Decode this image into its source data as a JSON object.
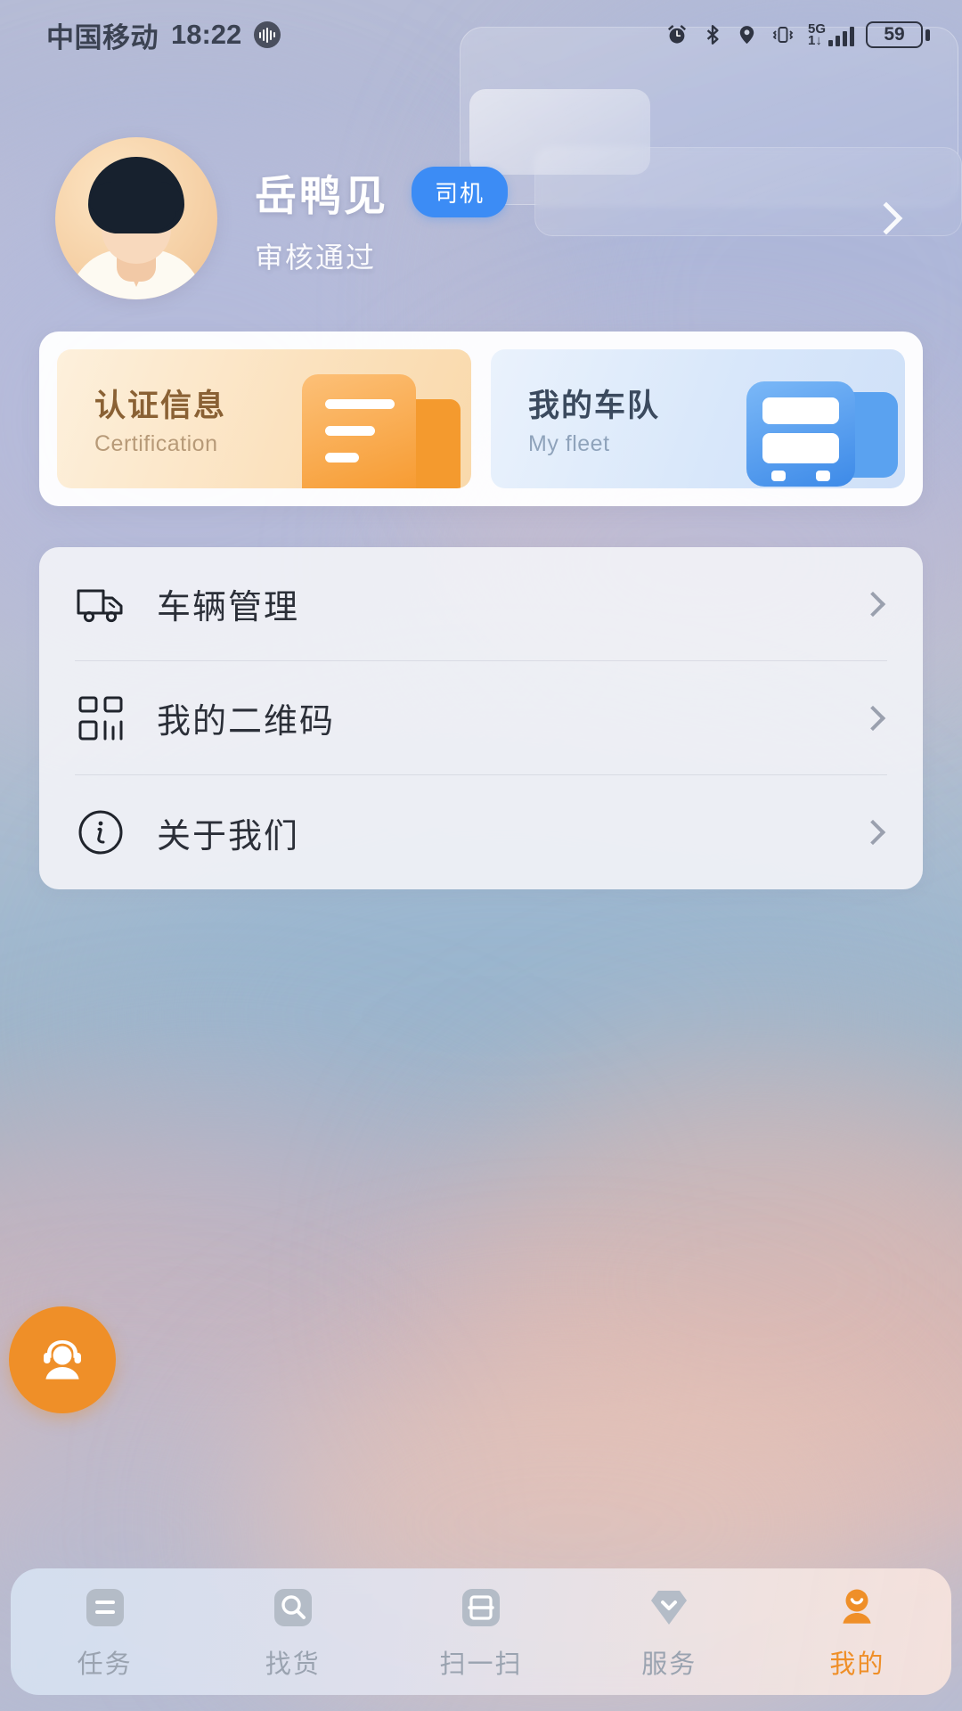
{
  "status_bar": {
    "carrier": "中国移动",
    "time": "18:22",
    "voice_icon": "voice-wave-icon",
    "icons": [
      "alarm-clock-icon",
      "bluetooth-icon",
      "location-icon",
      "vibrate-icon"
    ],
    "network_type_top": "5G",
    "network_type_bottom": "1↓",
    "battery_percent": "59"
  },
  "profile": {
    "name": "岳鸭见",
    "badge": "司机",
    "status": "审核通过",
    "avatar_name": "user-avatar",
    "arrow_icon": "chevron-right-icon"
  },
  "feature_cards": [
    {
      "title": "认证信息",
      "subtitle": "Certification",
      "icon": "document-icon",
      "accent": "#f79c33"
    },
    {
      "title": "我的车队",
      "subtitle": "My fleet",
      "icon": "bus-icon",
      "accent": "#3d8ae8"
    }
  ],
  "menu": {
    "items": [
      {
        "label": "车辆管理",
        "icon": "truck-icon"
      },
      {
        "label": "我的二维码",
        "icon": "qr-code-icon"
      },
      {
        "label": "关于我们",
        "icon": "info-circle-icon"
      }
    ]
  },
  "fab": {
    "icon": "customer-service-icon",
    "color": "#ef8f28"
  },
  "tabbar": {
    "active_color": "#ef8f28",
    "inactive_color": "#9aa3b0",
    "items": [
      {
        "label": "任务",
        "icon": "task-list-icon",
        "active": false
      },
      {
        "label": "找货",
        "icon": "search-goods-icon",
        "active": false
      },
      {
        "label": "扫一扫",
        "icon": "scan-icon",
        "active": false
      },
      {
        "label": "服务",
        "icon": "diamond-service-icon",
        "active": false
      },
      {
        "label": "我的",
        "icon": "person-icon",
        "active": true
      }
    ]
  }
}
